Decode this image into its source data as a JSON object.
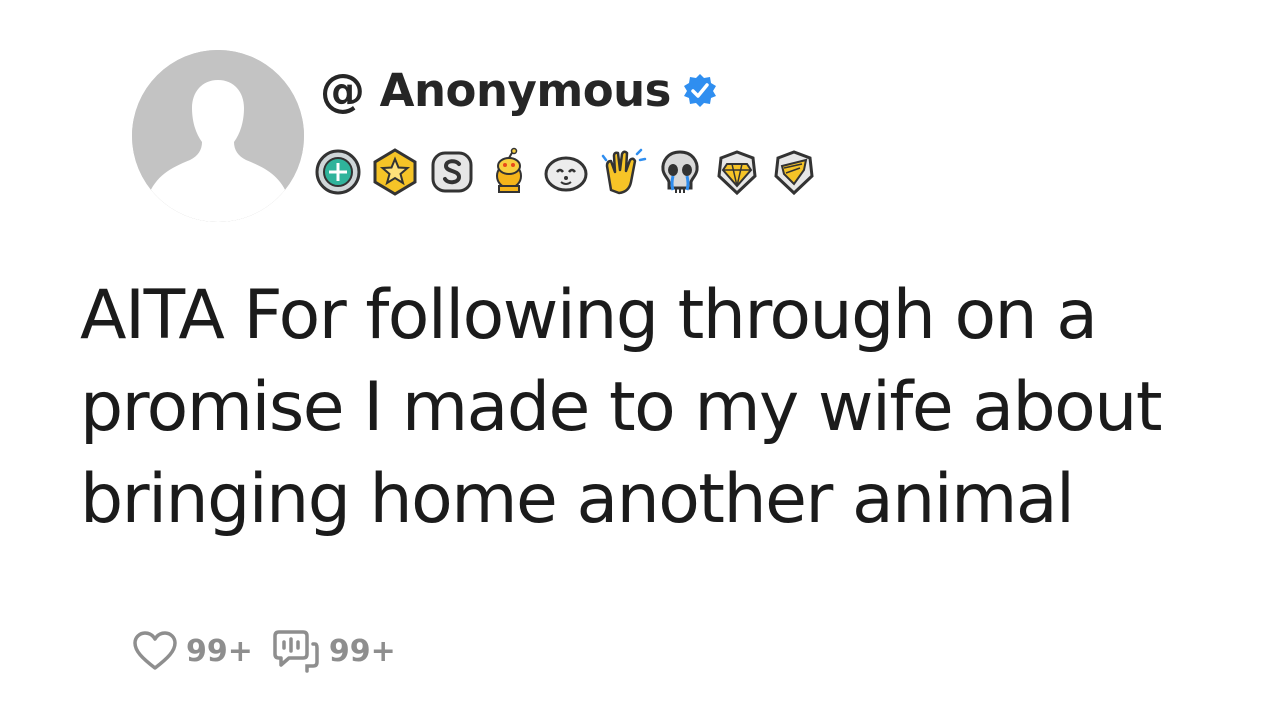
{
  "post": {
    "username": "@ Anonymous",
    "verified_icon": "verified-check-icon",
    "accent_color": "#2f8ef0",
    "title": "AITA For following through on a promise I made to my wife about bringing home another animal"
  },
  "badges": [
    "silver-orb-award-icon",
    "gold-star-award-icon",
    "silver-s-award-icon",
    "gold-snoo-award-icon",
    "wholesome-seal-award-icon",
    "clapping-hands-award-icon",
    "crying-skull-award-icon",
    "gold-diamond-award-icon",
    "silver-wing-award-icon"
  ],
  "stats": {
    "likes": "99+",
    "comments": "99+"
  }
}
